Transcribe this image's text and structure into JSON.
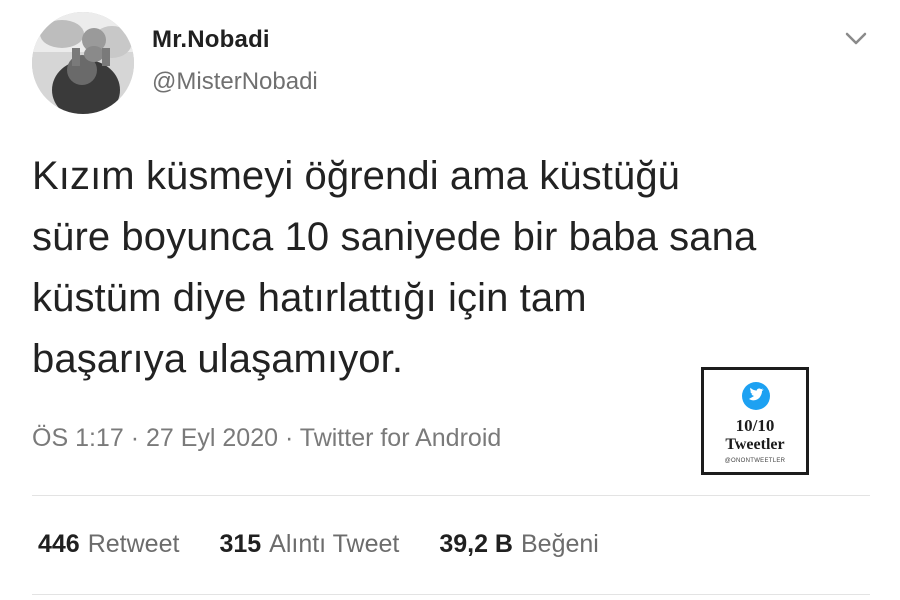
{
  "user": {
    "display_name": "Mr.Nobadi",
    "handle": "@MisterNobadi",
    "avatar_icon": "avatar-photo"
  },
  "menu_icon": "chevron-down-icon",
  "tweet": {
    "lines": [
      "Kızım küsmeyi öğrendi ama küstüğü",
      "süre boyunca 10 saniyede bir baba sana",
      "küstüm diye hatırlattığı için tam",
      "başarıya ulaşamıyor."
    ],
    "time": "ÖS 1:17",
    "date": "27 Eyl 2020",
    "separator": "·",
    "source": "Twitter for Android"
  },
  "stats": {
    "retweets": {
      "count": "446",
      "label": "Retweet"
    },
    "quotes": {
      "count": "315",
      "label": "Alıntı Tweet"
    },
    "likes": {
      "count": "39,2 B",
      "label": "Beğeni"
    }
  },
  "badge": {
    "score": "10/10",
    "title": "Tweetler",
    "credit": "@ONONTWEETLER",
    "icon": "twitter-bird-icon",
    "accent_color": "#1da1f2"
  }
}
